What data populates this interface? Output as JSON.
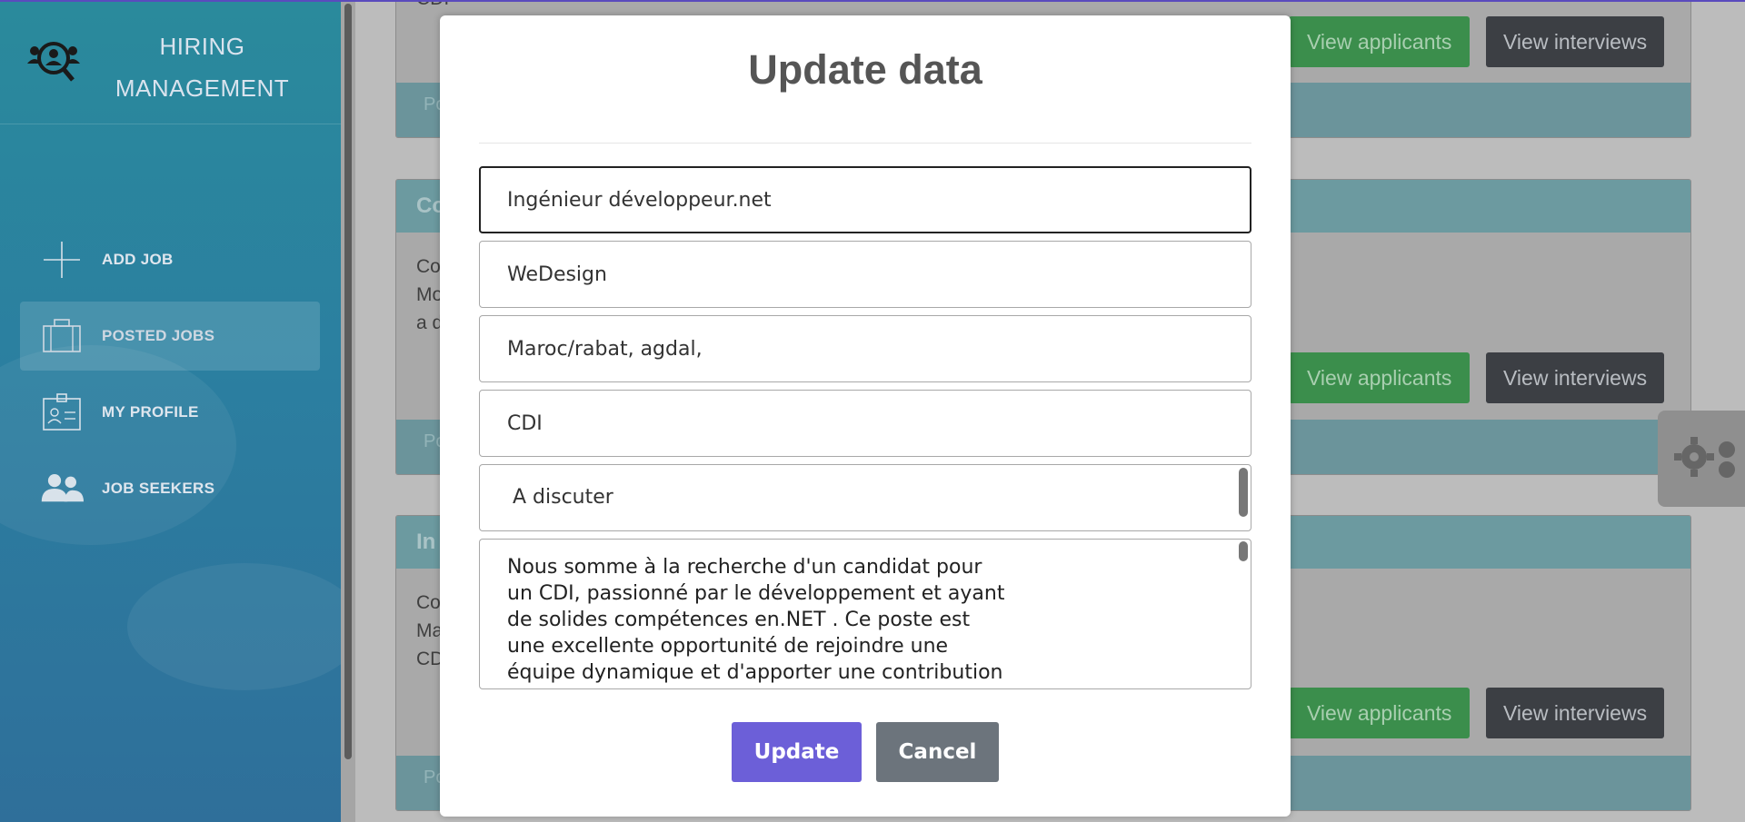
{
  "sidebar": {
    "brand_line1": "HIRING",
    "brand_line2": "MANAGEMENT",
    "logo_icon": "team-search-icon",
    "items": [
      {
        "label": "ADD JOB",
        "icon": "plus-icon",
        "active": false
      },
      {
        "label": "POSTED JOBS",
        "icon": "briefcase-icon",
        "active": true
      },
      {
        "label": "MY PROFILE",
        "icon": "id-card-icon",
        "active": false
      },
      {
        "label": "JOB SEEKERS",
        "icon": "users-icon",
        "active": false
      }
    ]
  },
  "cards": [
    {
      "header": "",
      "body_lines": [
        "CDI"
      ],
      "footer": "Po",
      "applicants_label": "View applicants",
      "interviews_label": "View interviews"
    },
    {
      "header": "Co",
      "body_lines": [
        "Co",
        "Mo",
        "a d"
      ],
      "footer": "Po",
      "applicants_label": "View applicants",
      "interviews_label": "View interviews"
    },
    {
      "header": "In",
      "body_lines": [
        "Co",
        "Ma",
        "CD"
      ],
      "footer": "Po",
      "applicants_label": "View applicants",
      "interviews_label": "View interviews"
    }
  ],
  "settings_icon": "gears-icon",
  "modal": {
    "title": "Update data",
    "fields": {
      "job_title": "Ingénieur développeur.net",
      "company": "WeDesign",
      "location": "Maroc/rabat, agdal,",
      "contract": "CDI",
      "salary": "A discuter"
    },
    "description_lines": [
      "Nous somme à la recherche d'un candidat pour",
      "un CDI, passionné par le développement et ayant",
      "de solides compétences en.NET . Ce poste est",
      "une excellente opportunité de rejoindre une",
      "équipe dynamique et d'apporter une contribution"
    ],
    "update_label": "Update",
    "cancel_label": "Cancel"
  },
  "colors": {
    "accent": "#6c5fd8",
    "sidebar": "#2b7fa0",
    "green_button": "#3b8e4c",
    "dark_button": "#3c3f44"
  }
}
